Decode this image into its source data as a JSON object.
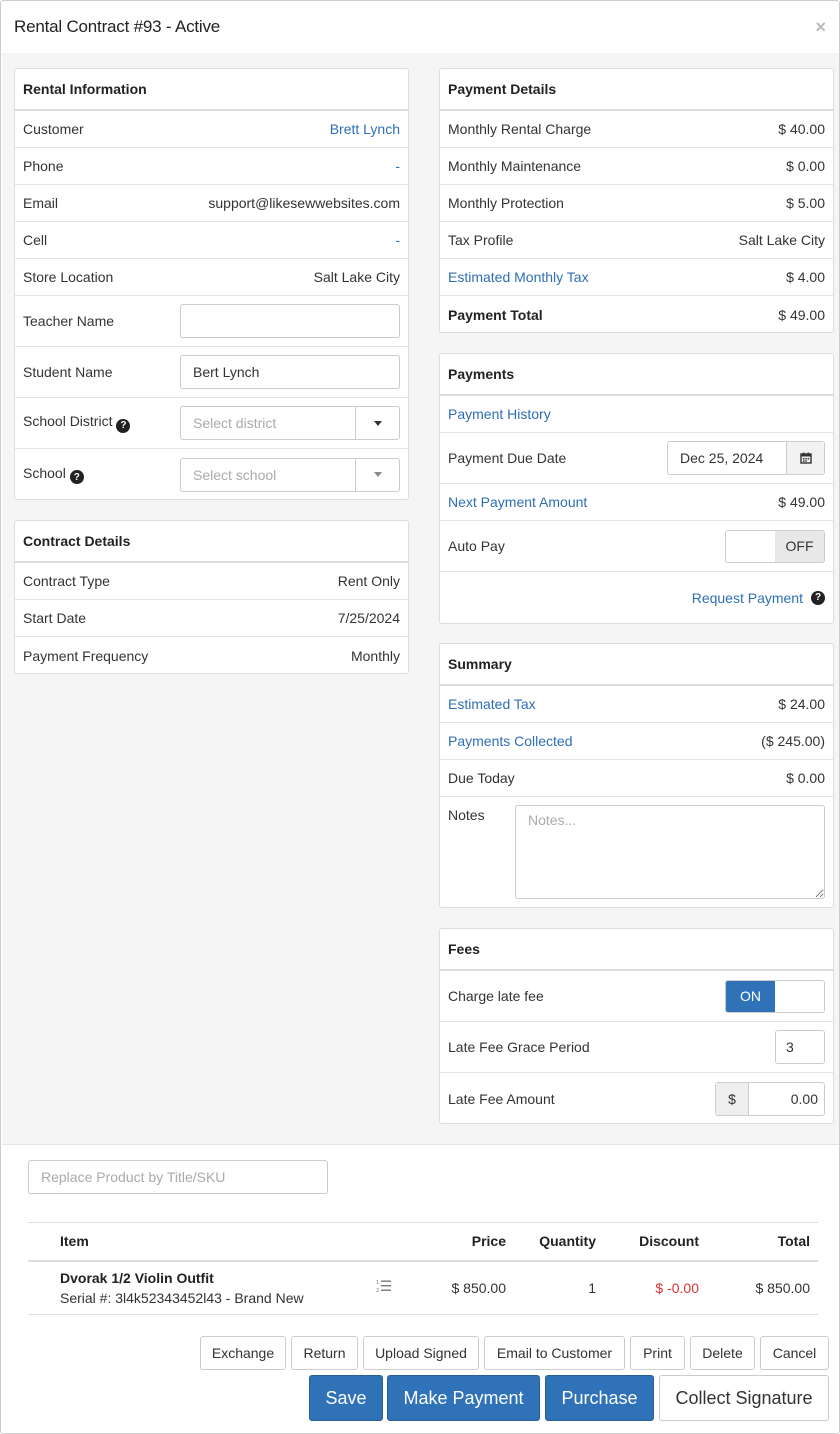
{
  "modal": {
    "title": "Rental Contract #93 - Active",
    "close": "×"
  },
  "rental_info": {
    "heading": "Rental Information",
    "customer_label": "Customer",
    "customer_value": "Brett Lynch",
    "phone_label": "Phone",
    "phone_value": "-",
    "email_label": "Email",
    "email_value": "support@likesewwebsites.com",
    "cell_label": "Cell",
    "cell_value": "-",
    "store_label": "Store Location",
    "store_value": "Salt Lake City",
    "teacher_label": "Teacher Name",
    "teacher_value": "",
    "student_label": "Student Name",
    "student_value": "Bert Lynch",
    "district_label": "School District",
    "district_placeholder": "Select district",
    "school_label": "School",
    "school_placeholder": "Select school",
    "help_glyph": "?"
  },
  "contract_details": {
    "heading": "Contract Details",
    "type_label": "Contract Type",
    "type_value": "Rent Only",
    "start_label": "Start Date",
    "start_value": "7/25/2024",
    "freq_label": "Payment Frequency",
    "freq_value": "Monthly"
  },
  "payment_details": {
    "heading": "Payment Details",
    "rows": [
      {
        "label": "Monthly Rental Charge",
        "value": "$ 40.00"
      },
      {
        "label": "Monthly Maintenance",
        "value": "$ 0.00"
      },
      {
        "label": "Monthly Protection",
        "value": "$ 5.00"
      },
      {
        "label": "Tax Profile",
        "value": "Salt Lake City"
      },
      {
        "label": "Estimated Monthly Tax",
        "value": "$ 4.00"
      },
      {
        "label": "Payment Total",
        "value": "$ 49.00"
      }
    ]
  },
  "payments": {
    "heading": "Payments",
    "history_link": "Payment History",
    "due_label": "Payment Due Date",
    "due_value": "Dec 25, 2024",
    "next_label": "Next Payment Amount",
    "next_value": "$ 49.00",
    "autopay_label": "Auto Pay",
    "autopay_state": "OFF",
    "request_link": "Request Payment"
  },
  "summary": {
    "heading": "Summary",
    "tax_label": "Estimated Tax",
    "tax_value": "$ 24.00",
    "collected_label": "Payments Collected",
    "collected_value": "($ 245.00)",
    "due_label": "Due Today",
    "due_value": "$ 0.00",
    "notes_label": "Notes",
    "notes_placeholder": "Notes..."
  },
  "fees": {
    "heading": "Fees",
    "late_label": "Charge late fee",
    "late_state": "ON",
    "grace_label": "Late Fee Grace Period",
    "grace_value": "3",
    "amount_label": "Late Fee Amount",
    "amount_prefix": "$",
    "amount_value": "0.00"
  },
  "products": {
    "search_placeholder": "Replace Product by Title/SKU",
    "columns": {
      "item": "Item",
      "price": "Price",
      "quantity": "Quantity",
      "discount": "Discount",
      "total": "Total"
    },
    "rows": [
      {
        "title": "Dvorak 1/2 Violin Outfit",
        "serial": "Serial #: 3l4k52343452l43 - Brand New",
        "price": "$ 850.00",
        "quantity": "1",
        "discount": "$ -0.00",
        "total": "$ 850.00"
      }
    ]
  },
  "actions": {
    "exchange": "Exchange",
    "return": "Return",
    "upload_signed": "Upload Signed",
    "email_customer": "Email to Customer",
    "print": "Print",
    "delete": "Delete",
    "cancel": "Cancel",
    "save": "Save",
    "make_payment": "Make Payment",
    "purchase": "Purchase",
    "collect_signature": "Collect Signature"
  },
  "colors": {
    "accent": "#2f72b8",
    "link": "#2f6eb5",
    "negative": "#d33333"
  }
}
